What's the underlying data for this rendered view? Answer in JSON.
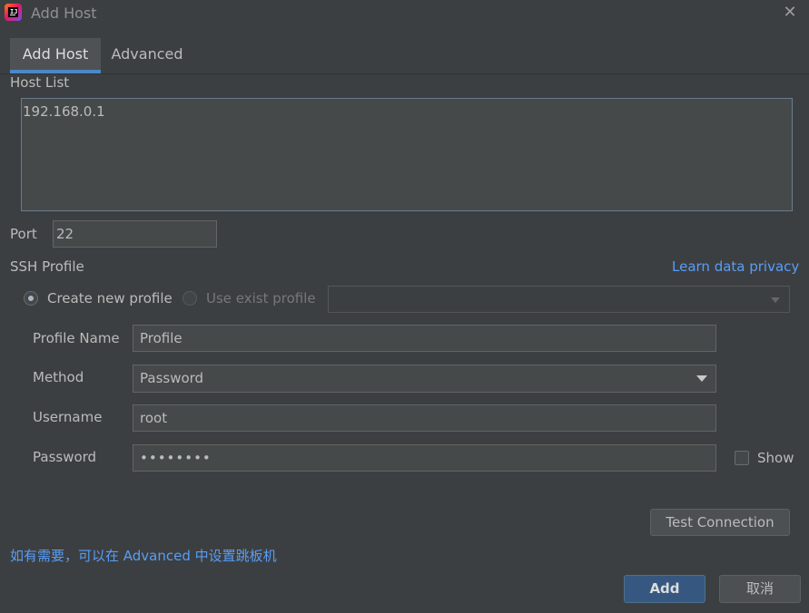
{
  "window": {
    "title": "Add Host"
  },
  "tabs": [
    {
      "label": "Add Host"
    },
    {
      "label": "Advanced"
    }
  ],
  "host_list": {
    "label": "Host List",
    "value": "192.168.0.1"
  },
  "port": {
    "label": "Port",
    "value": "22"
  },
  "ssh_profile": {
    "label": "SSH Profile",
    "privacy_link": "Learn data privacy",
    "create_new_label": "Create new profile",
    "use_exist_label": "Use exist profile",
    "selected_mode": "create_new",
    "existing_profile_value": ""
  },
  "form": {
    "profile_name": {
      "label": "Profile Name",
      "value": "Profile"
    },
    "method": {
      "label": "Method",
      "value": "Password"
    },
    "username": {
      "label": "Username",
      "value": "root"
    },
    "password": {
      "label": "Password",
      "value": "••••••••"
    },
    "show_label": "Show",
    "show_checked": false
  },
  "buttons": {
    "test_connection": "Test Connection",
    "add": "Add",
    "cancel": "取消"
  },
  "hint": "如有需要，可以在 Advanced 中设置跳板机",
  "colors": {
    "background": "#3c3f41",
    "accent": "#4a88c7",
    "link": "#589df6",
    "primary_button": "#365880"
  },
  "icons": {
    "app": "intellij-idea-icon",
    "close": "close-icon",
    "dropdown": "chevron-down-icon"
  }
}
